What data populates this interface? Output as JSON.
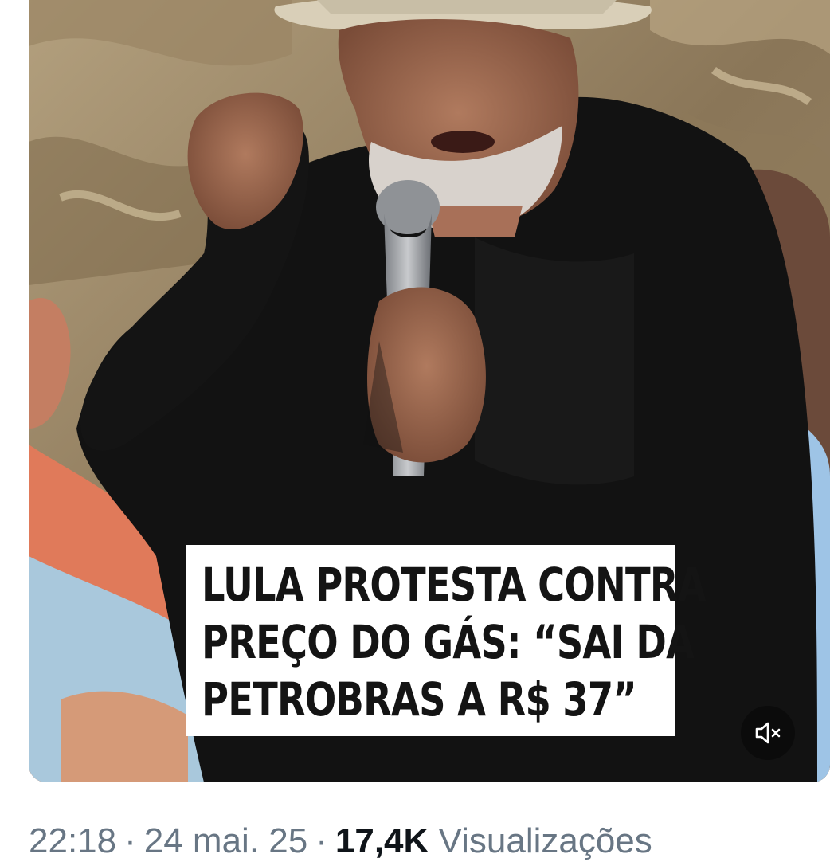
{
  "video": {
    "caption_lines": [
      "LULA PROTESTA CONTRA",
      "PREÇO DO GÁS: “SAI DA",
      "PETROBRAS A R$ 37”"
    ],
    "mute_icon": "speaker-muted-icon"
  },
  "tweet_meta": {
    "time": "22:18",
    "separator": "·",
    "date": "24 mai. 25",
    "views_count": "17,4K",
    "views_label": "Visualizações"
  },
  "colors": {
    "meta_text": "#687684",
    "views_count": "#0f1419",
    "caption_background": "#ffffff",
    "caption_text": "#141414",
    "mute_button_bg": "#0a0a0a"
  }
}
